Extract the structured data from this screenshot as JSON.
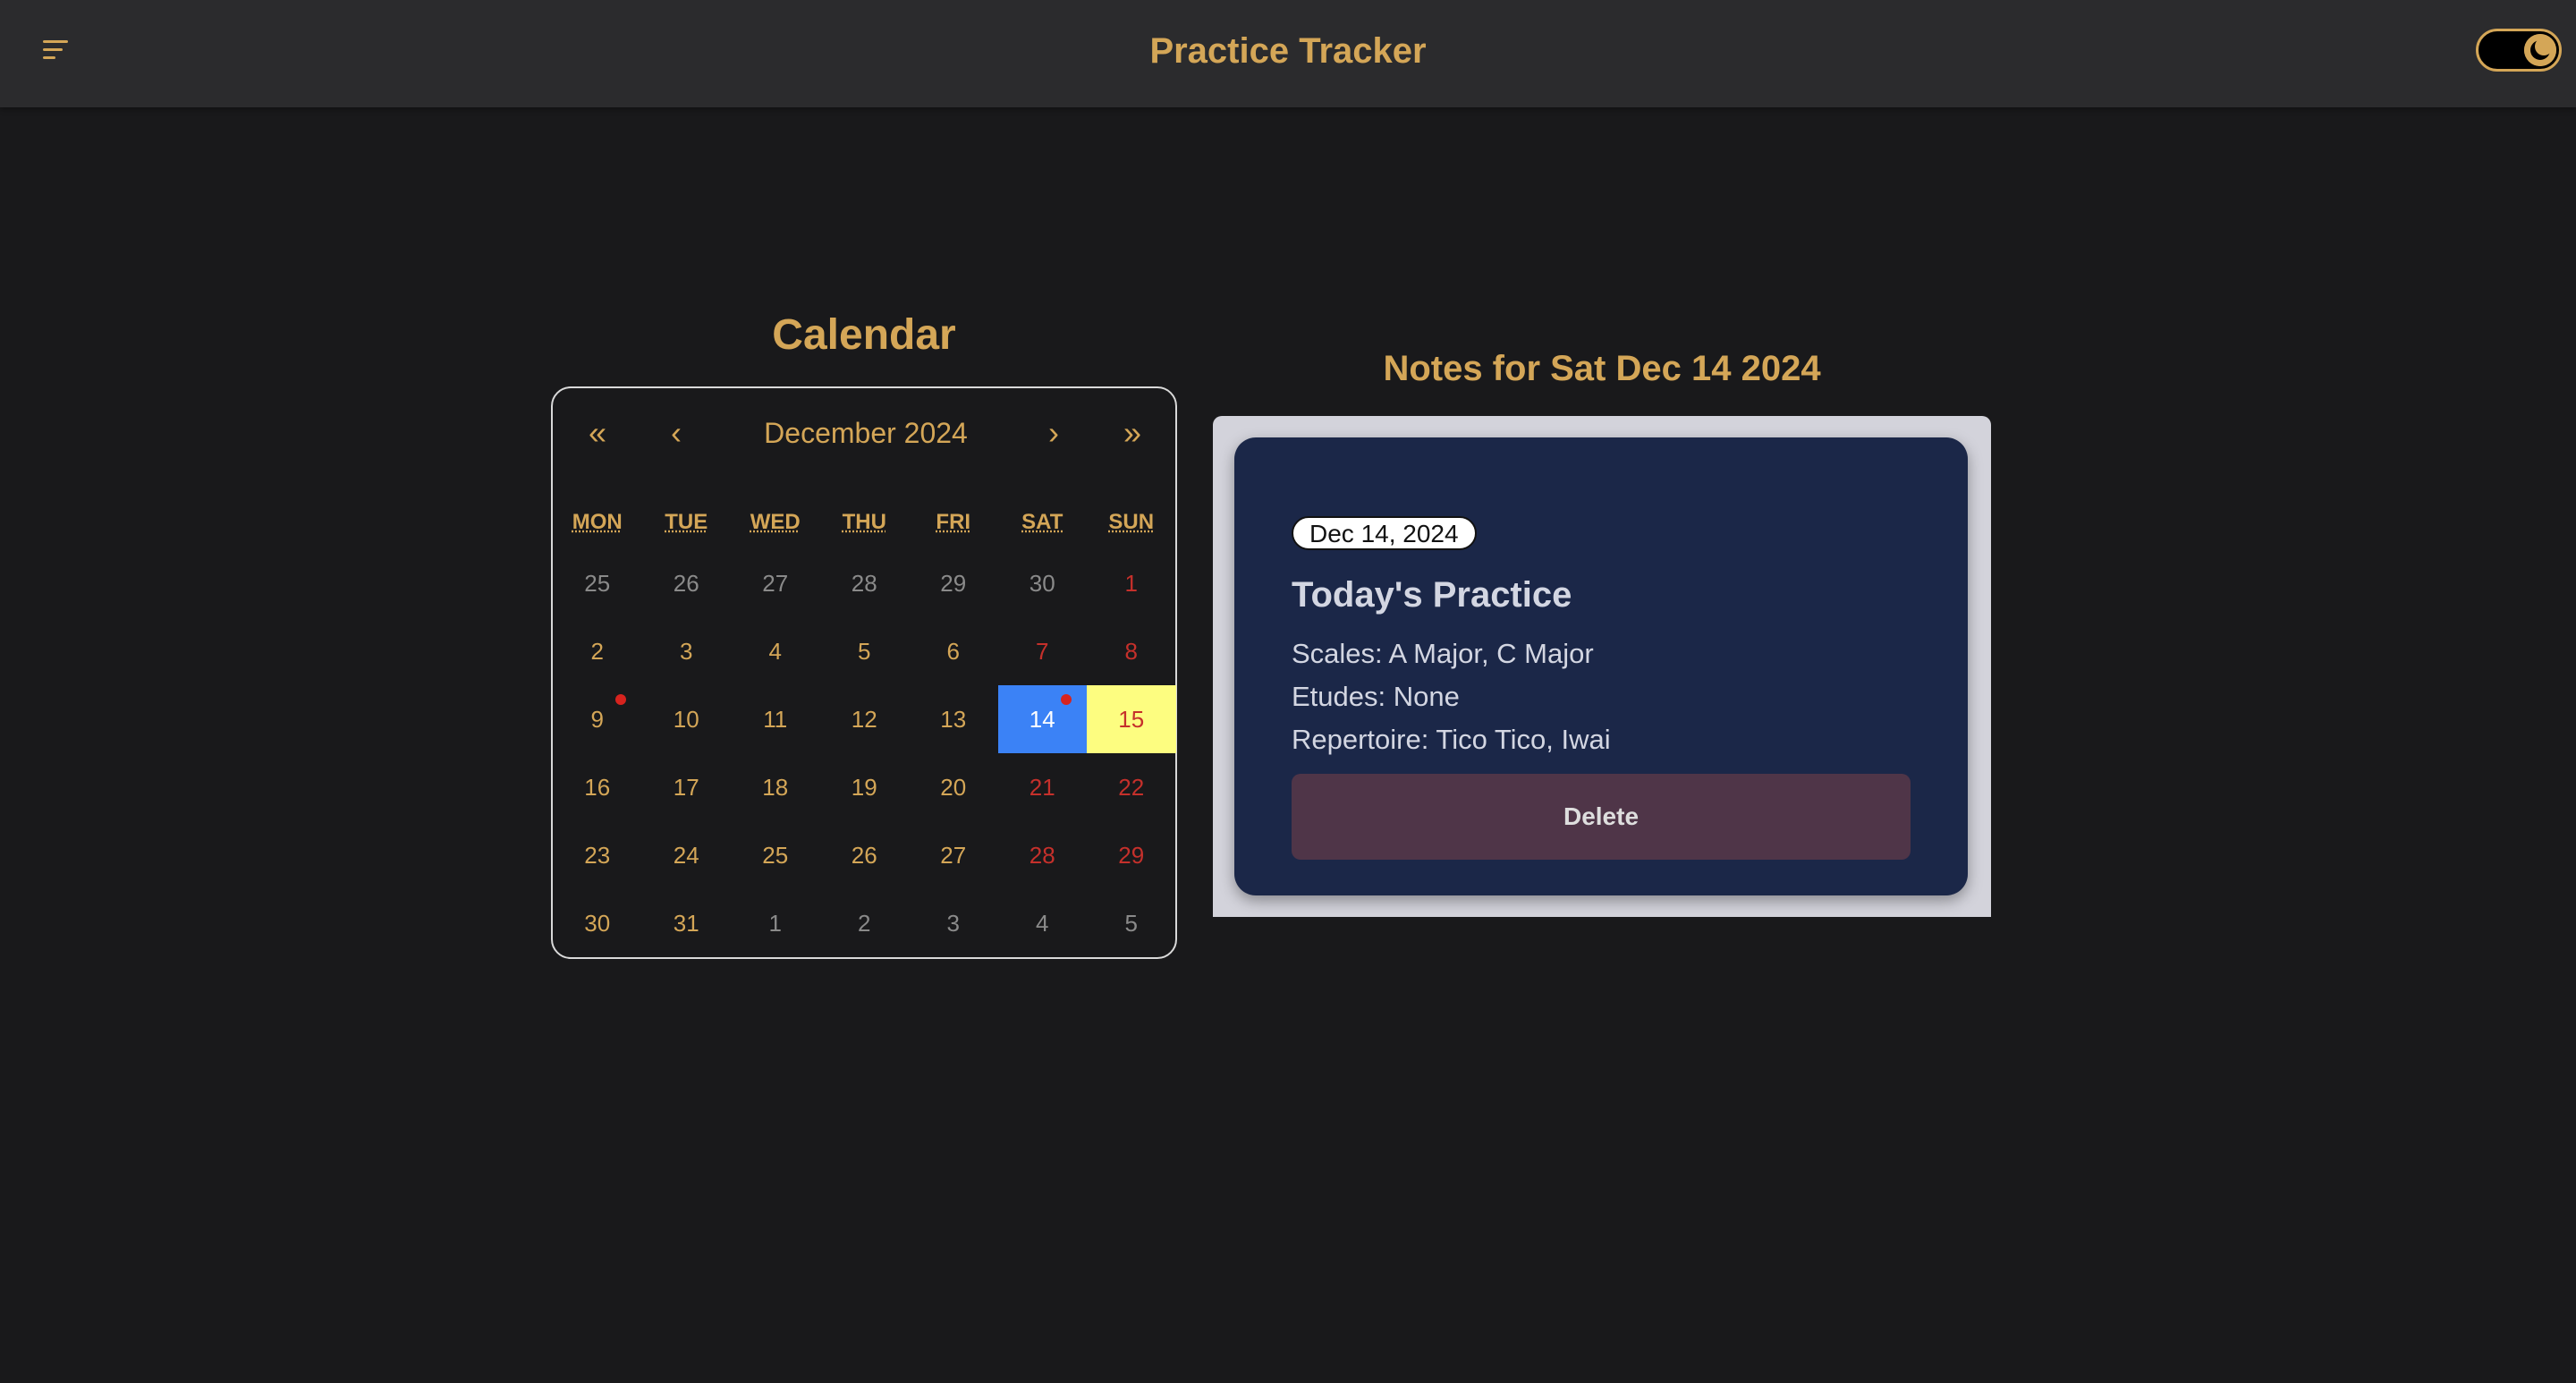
{
  "header": {
    "title": "Practice Tracker",
    "menu_icon": "menu-icon",
    "theme_toggle_icon": "moon-icon"
  },
  "colors": {
    "accent": "#d4a657",
    "background": "#19191b",
    "header_background": "#2b2b2d",
    "weekend": "#c5302b",
    "selected_day": "#3b82f6",
    "today": "#fdfd80",
    "note_card": "#1b2748",
    "delete_button": "#4f3548"
  },
  "calendar": {
    "title": "Calendar",
    "nav": {
      "prev_year": "«",
      "prev_month": "‹",
      "month_label": "December 2024",
      "next_month": "›",
      "next_year": "»"
    },
    "weekdays": [
      "MON",
      "TUE",
      "WED",
      "THU",
      "FRI",
      "SAT",
      "SUN"
    ],
    "days": [
      {
        "label": "25",
        "type": "other"
      },
      {
        "label": "26",
        "type": "other"
      },
      {
        "label": "27",
        "type": "other"
      },
      {
        "label": "28",
        "type": "other"
      },
      {
        "label": "29",
        "type": "other"
      },
      {
        "label": "30",
        "type": "other"
      },
      {
        "label": "1",
        "type": "weekend"
      },
      {
        "label": "2",
        "type": "normal"
      },
      {
        "label": "3",
        "type": "normal"
      },
      {
        "label": "4",
        "type": "normal"
      },
      {
        "label": "5",
        "type": "normal"
      },
      {
        "label": "6",
        "type": "normal"
      },
      {
        "label": "7",
        "type": "weekend"
      },
      {
        "label": "8",
        "type": "weekend"
      },
      {
        "label": "9",
        "type": "normal",
        "has_note": true
      },
      {
        "label": "10",
        "type": "normal"
      },
      {
        "label": "11",
        "type": "normal"
      },
      {
        "label": "12",
        "type": "normal"
      },
      {
        "label": "13",
        "type": "normal"
      },
      {
        "label": "14",
        "type": "selected",
        "has_note": true
      },
      {
        "label": "15",
        "type": "today"
      },
      {
        "label": "16",
        "type": "normal"
      },
      {
        "label": "17",
        "type": "normal"
      },
      {
        "label": "18",
        "type": "normal"
      },
      {
        "label": "19",
        "type": "normal"
      },
      {
        "label": "20",
        "type": "normal"
      },
      {
        "label": "21",
        "type": "weekend"
      },
      {
        "label": "22",
        "type": "weekend"
      },
      {
        "label": "23",
        "type": "normal"
      },
      {
        "label": "24",
        "type": "normal"
      },
      {
        "label": "25",
        "type": "normal"
      },
      {
        "label": "26",
        "type": "normal"
      },
      {
        "label": "27",
        "type": "normal"
      },
      {
        "label": "28",
        "type": "weekend"
      },
      {
        "label": "29",
        "type": "weekend"
      },
      {
        "label": "30",
        "type": "normal"
      },
      {
        "label": "31",
        "type": "normal"
      },
      {
        "label": "1",
        "type": "other"
      },
      {
        "label": "2",
        "type": "other"
      },
      {
        "label": "3",
        "type": "other"
      },
      {
        "label": "4",
        "type": "other"
      },
      {
        "label": "5",
        "type": "other"
      }
    ]
  },
  "notes": {
    "title": "Notes for Sat Dec 14 2024",
    "card": {
      "date_badge": "Dec 14, 2024",
      "heading": "Today's Practice",
      "scales": "Scales: A Major, C Major",
      "etudes": "Etudes: None",
      "repertoire": "Repertoire: Tico Tico, Iwai",
      "delete_label": "Delete"
    }
  }
}
